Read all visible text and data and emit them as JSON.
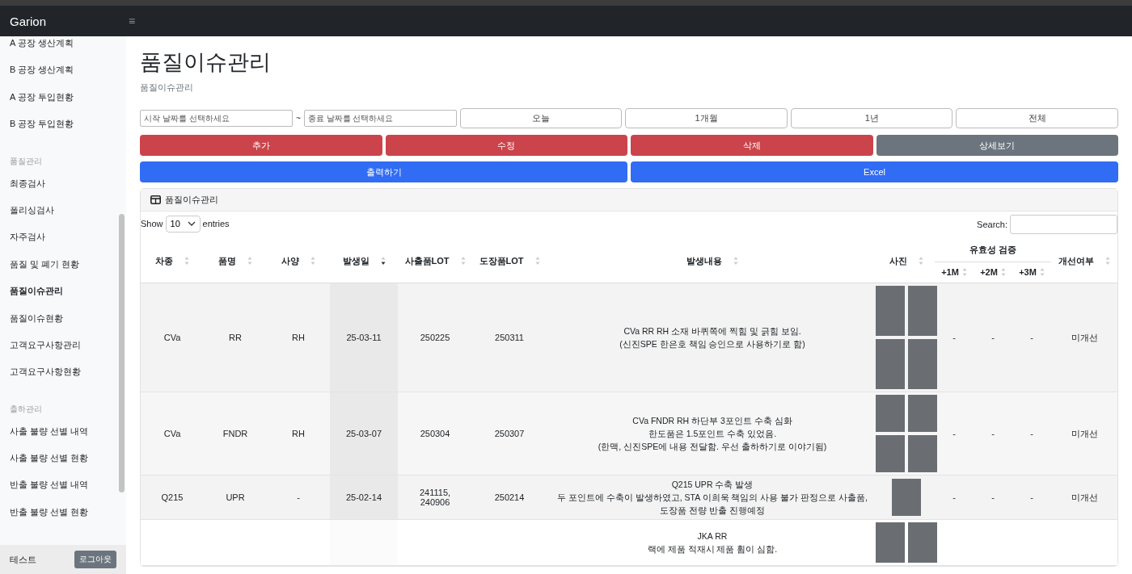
{
  "navbar": {
    "brand": "Garion",
    "menu_toggle": "≡"
  },
  "sidebar": {
    "groups": [
      {
        "items": [
          {
            "label": "A 공장 생산계획",
            "selected": false
          },
          {
            "label": "B 공장 생산계획",
            "selected": false
          },
          {
            "label": "A 공장 투입현황",
            "selected": false
          },
          {
            "label": "B 공장 투입현황",
            "selected": false
          }
        ]
      },
      {
        "heading": "품질관리",
        "items": [
          {
            "label": "최종검사",
            "selected": false
          },
          {
            "label": "폴리싱검사",
            "selected": false
          },
          {
            "label": "자주검사",
            "selected": false
          },
          {
            "label": "품질 및 폐기 현황",
            "selected": false
          },
          {
            "label": "품질이슈관리",
            "selected": true
          },
          {
            "label": "품질이슈현황",
            "selected": false
          },
          {
            "label": "고객요구사항관리",
            "selected": false
          },
          {
            "label": "고객요구사항현황",
            "selected": false
          }
        ]
      },
      {
        "heading": "출하관리",
        "items": [
          {
            "label": "사출 불량 선별 내역",
            "selected": false
          },
          {
            "label": "사출 불량 선별 현황",
            "selected": false
          },
          {
            "label": "반출 불량 선별 내역",
            "selected": false
          },
          {
            "label": "반출 불량 선별 현황",
            "selected": false
          }
        ]
      }
    ],
    "user": "테스트",
    "logout": "로그아웃"
  },
  "page": {
    "title": "품질이슈관리",
    "breadcrumb": "품질이슈관리"
  },
  "filters": {
    "start_placeholder": "시작 날짜를 선택하세요",
    "separator": "~",
    "end_placeholder": "종료 날짜를 선택하세요",
    "ranges": [
      "오늘",
      "1개월",
      "1년",
      "전체"
    ]
  },
  "actions": [
    {
      "label": "추가",
      "kind": "danger"
    },
    {
      "label": "수정",
      "kind": "danger"
    },
    {
      "label": "삭제",
      "kind": "danger"
    },
    {
      "label": "상세보기",
      "kind": "secondary"
    }
  ],
  "exports": [
    {
      "label": "출력하기",
      "kind": "primary"
    },
    {
      "label": "Excel",
      "kind": "primary"
    }
  ],
  "table": {
    "title": "품질이슈관리",
    "show_label": "Show",
    "page_size": "10",
    "entries_label": "entries",
    "search_label": "Search:",
    "columns": [
      {
        "label": "차종",
        "sorted": false
      },
      {
        "label": "품명",
        "sorted": false
      },
      {
        "label": "사양",
        "sorted": false
      },
      {
        "label": "발생일",
        "sorted": true
      },
      {
        "label": "사출품LOT",
        "sorted": false
      },
      {
        "label": "도장품LOT",
        "sorted": false
      },
      {
        "label": "발생내용",
        "sorted": false
      },
      {
        "label": "사진",
        "sorted": false
      }
    ],
    "group_column": {
      "label": "유효성 검증",
      "children": [
        {
          "label": "+1M",
          "sorted": false
        },
        {
          "label": "+2M",
          "sorted": false
        },
        {
          "label": "+3M",
          "sorted": false
        }
      ]
    },
    "last_column": {
      "label": "개선여부",
      "sorted": false
    },
    "rows": [
      {
        "cells": [
          "CVa",
          "RR",
          "RH",
          "25-03-11",
          "250225",
          "250311"
        ],
        "content": [
          "CVa RR RH 소재 바퀴쪽에 찍힘 및 긁힘 보임.",
          "(신진SPE 한은호 책임 승인으로 사용하기로 함)"
        ],
        "photos": [
          {
            "kind": "photo"
          },
          {
            "kind": "photo"
          },
          {
            "kind": "photo"
          },
          {
            "kind": "photo"
          }
        ],
        "checks": [
          "-",
          "-",
          "-"
        ],
        "status": "미개선"
      },
      {
        "cells": [
          "CVa",
          "FNDR",
          "RH",
          "25-03-07",
          "250304",
          "250307"
        ],
        "content": [
          "CVa FNDR RH 하단부 3포인트 수축 심화",
          "한도품은 1.5포인트 수축 있었음.",
          "(한맥, 신진SPE에 내용 전달함. 우선 출하하기로 이야기됨)"
        ],
        "photos": [
          {
            "kind": "photo"
          },
          {
            "kind": "photo"
          },
          {
            "kind": "photo"
          },
          {
            "kind": "photo"
          }
        ],
        "checks": [
          "-",
          "-",
          "-"
        ],
        "status": "미개선"
      },
      {
        "cells": [
          "Q215",
          "UPR",
          "-",
          "25-02-14",
          "241115,\n240906",
          "250214"
        ],
        "content": [
          "Q215 UPR 수축 발생",
          "두 포인트에 수축이 발생하였고, STA 이희욱 책임의 사용 불가 판정으로 사출품,",
          "도장품 전량 반출 진행예정"
        ],
        "photos": [
          {
            "kind": "photo"
          }
        ],
        "checks": [
          "-",
          "-",
          "-"
        ],
        "status": "미개선"
      },
      {
        "cells": [],
        "content": [
          "JKA RR",
          "랙에 제품 적재시 제품 휨이 심함."
        ],
        "photos": [
          {
            "kind": "photo"
          },
          {
            "kind": "photo"
          }
        ],
        "checks": []
      }
    ]
  }
}
